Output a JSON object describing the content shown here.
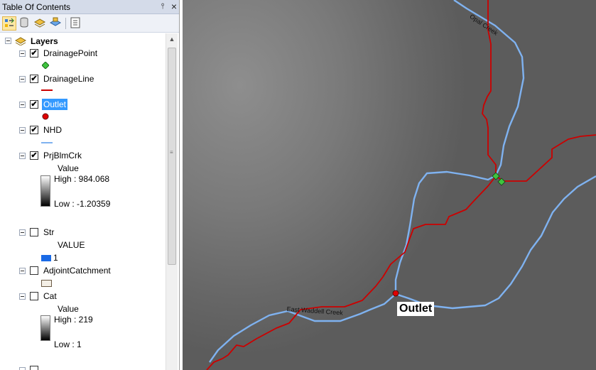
{
  "toc": {
    "title": "Table Of Contents",
    "pin_glyph": "⫯",
    "close_glyph": "×",
    "tools": [
      "list-by-drawing-order-icon",
      "list-by-source-icon",
      "list-by-visibility-icon",
      "list-by-selection-icon",
      "options-icon"
    ],
    "root_label": "Layers",
    "layers": {
      "drainage_point": {
        "label": "DrainagePoint",
        "checked": true,
        "check_glyph": "✔"
      },
      "drainage_line": {
        "label": "DrainageLine",
        "checked": true,
        "check_glyph": "✔"
      },
      "outlet": {
        "label": "Outlet",
        "checked": true,
        "check_glyph": "✔"
      },
      "nhd": {
        "label": "NHD",
        "checked": true,
        "check_glyph": "✔"
      },
      "prjblmcrk": {
        "label": "PrjBlmCrk",
        "checked": true,
        "check_glyph": "✔",
        "legend_heading": "Value",
        "high": "High : 984.068",
        "low": "Low : -1.20359"
      },
      "str": {
        "label": "Str",
        "checked": false,
        "legend_heading": "VALUE",
        "class_label": "1"
      },
      "adjoint_catchment": {
        "label": "AdjointCatchment",
        "checked": false
      },
      "cat": {
        "label": "Cat",
        "checked": false,
        "legend_heading": "Value",
        "high": "High : 219",
        "low": "Low : 1"
      }
    }
  },
  "map": {
    "labels": {
      "opal_creek": "Opal Creek",
      "east_waddell_creek": "East Waddell Creek",
      "outlet": "Outlet"
    }
  },
  "colors": {
    "drainage_line": "#cc0000",
    "nhd_stream": "#7fb2f0",
    "drainage_point": "#3ec43e",
    "outlet_point": "#e00000",
    "selection": "#3399ff",
    "str_class": "#1a6ae6"
  }
}
